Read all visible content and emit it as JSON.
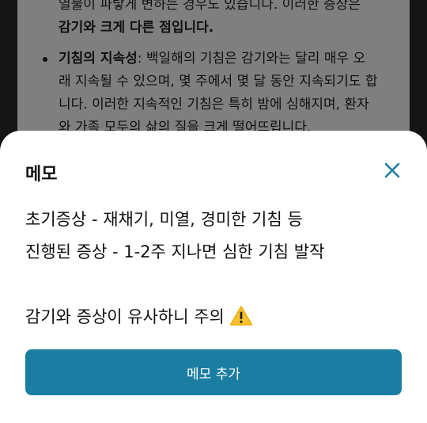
{
  "article": {
    "partial_line_1": "열물이 파랗게 변하는 경우도 있습니다. 이러한 증상은",
    "bold_line": "감기와 크게 다른 점입니다.",
    "bold_line_suffix": "",
    "bullet_title": "기침의 지속성",
    "bullet_line_1_rest": ": 백일해의 기침은 감기와는 달리 매우 오",
    "bullet_line_2": "래 지속될 수 있으며, 몇 주에서 몇 달 동안 지속되기도 합",
    "bullet_line_3": "니다. 이러한 지속적인 기침은 특히 밤에 심해지며, 환자",
    "bullet_line_4": "와 가족 모두의 삶의 질을 크게 떨어뜨립니다."
  },
  "memo_sheet": {
    "title": "메모",
    "close_icon": "close-icon",
    "lines": [
      "초기증상 - 재채기, 미열, 경미한 기침 등",
      "진행된 증상 - 1-2주 지나면 심한 기침 발작"
    ],
    "warning_line": "감기와 증상이 유사하니 주의",
    "warning_icon": "warning-icon",
    "add_button_label": "메모 추가"
  },
  "colors": {
    "accent": "#1b7da2",
    "close_icon": "#1b7da2",
    "warning_yellow": "#f7c12f"
  }
}
